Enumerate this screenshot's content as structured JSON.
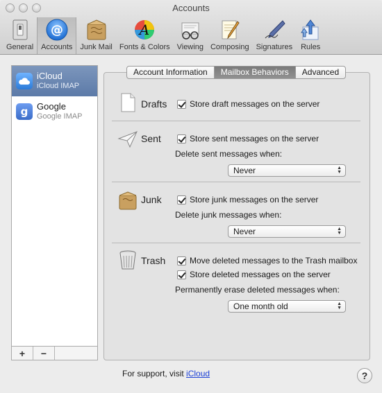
{
  "window": {
    "title": "Accounts"
  },
  "toolbar": {
    "items": [
      {
        "label": "General",
        "icon": "light-switch-icon"
      },
      {
        "label": "Accounts",
        "icon": "at-sign-icon",
        "selected": true
      },
      {
        "label": "Junk Mail",
        "icon": "junk-mail-box-icon"
      },
      {
        "label": "Fonts & Colors",
        "icon": "fonts-colors-icon"
      },
      {
        "label": "Viewing",
        "icon": "glasses-icon"
      },
      {
        "label": "Composing",
        "icon": "notepad-pen-icon"
      },
      {
        "label": "Signatures",
        "icon": "fountain-pen-icon"
      },
      {
        "label": "Rules",
        "icon": "rules-arrows-icon"
      }
    ]
  },
  "accounts": [
    {
      "name": "iCloud",
      "type": "iCloud IMAP",
      "icon": "cloud-icon",
      "selected": true,
      "color": "#3f8fe0"
    },
    {
      "name": "Google",
      "type": "Google IMAP",
      "icon": "google-g-icon",
      "selected": false,
      "color": "#4a7fd8"
    }
  ],
  "sidebar_buttons": {
    "add": "+",
    "remove": "−"
  },
  "tabs": [
    {
      "label": "Account Information",
      "active": false
    },
    {
      "label": "Mailbox Behaviors",
      "active": true
    },
    {
      "label": "Advanced",
      "active": false
    }
  ],
  "drafts": {
    "label": "Drafts",
    "store_on_server": "Store draft messages on the server"
  },
  "sent": {
    "label": "Sent",
    "store_on_server": "Store sent messages on the server",
    "delete_when_label": "Delete sent messages when:",
    "delete_when_value": "Never"
  },
  "junk": {
    "label": "Junk",
    "store_on_server": "Store junk messages on the server",
    "delete_when_label": "Delete junk messages when:",
    "delete_when_value": "Never"
  },
  "trash": {
    "label": "Trash",
    "move_to_trash": "Move deleted messages to the Trash mailbox",
    "store_on_server": "Store deleted messages on the server",
    "erase_when_label": "Permanently erase deleted messages when:",
    "erase_when_value": "One month old"
  },
  "footer": {
    "support_text": "For support, visit",
    "support_link": "iCloud",
    "help": "?"
  }
}
